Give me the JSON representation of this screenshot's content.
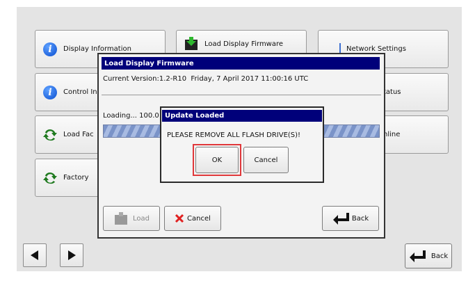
{
  "menu": {
    "display_information": "Display Information",
    "load_display_firmware": "Load Display Firmware",
    "network_settings": "Network Settings",
    "control_information": "Control In",
    "status": "tatus",
    "load_factory": "Load Fac",
    "online": "nline",
    "factory": "Factory"
  },
  "firmware_dialog": {
    "title": "Load Display Firmware",
    "current_version": "Current Version:1.2-R10  Friday, 7 April 2017 11:00:16 UTC",
    "loading_text": "Loading... 100.0",
    "progress_fraction": 1.0,
    "load_label": "Load",
    "cancel_label": "Cancel",
    "back_label": "Back"
  },
  "update_dialog": {
    "title": "Update Loaded",
    "message": "PLEASE REMOVE ALL FLASH DRIVE(S)!",
    "ok_label": "OK",
    "cancel_label": "Cancel"
  },
  "footer": {
    "back_label": "Back"
  },
  "colors": {
    "title_bar": "#00007a",
    "highlight": "#e0383b",
    "info_blue": "#0b4fd0",
    "refresh_green": "#1f7a1f"
  }
}
